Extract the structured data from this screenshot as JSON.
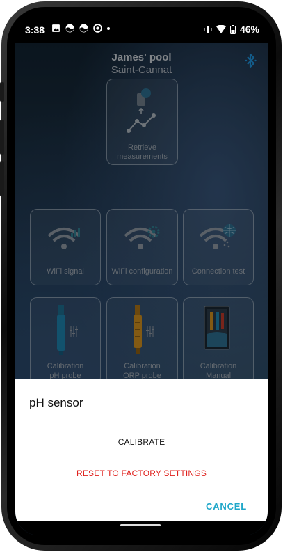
{
  "status_bar": {
    "time": "3:38",
    "battery": "46%"
  },
  "header": {
    "pool_name": "James' pool",
    "location": "Saint-Cannat"
  },
  "tiles": {
    "retrieve": {
      "line1": "Retrieve",
      "line2": "measurements"
    },
    "wifi_signal": "WiFi signal",
    "wifi_config": "WiFi configuration",
    "connection_test": "Connection test",
    "cal_ph": {
      "line1": "Calibration",
      "line2": "pH probe"
    },
    "cal_orp": {
      "line1": "Calibration",
      "line2": "ORP probe"
    },
    "cal_manual": {
      "line1": "Calibration",
      "line2": "Manual"
    }
  },
  "sheet": {
    "title": "pH sensor",
    "calibrate": "CALIBRATE",
    "reset": "RESET TO FACTORY SETTINGS",
    "cancel": "CANCEL"
  },
  "colors": {
    "accent": "#1fa7c9",
    "danger": "#e0211d",
    "ph_probe": "#1c7fa8",
    "orp_probe": "#c98a1e"
  }
}
